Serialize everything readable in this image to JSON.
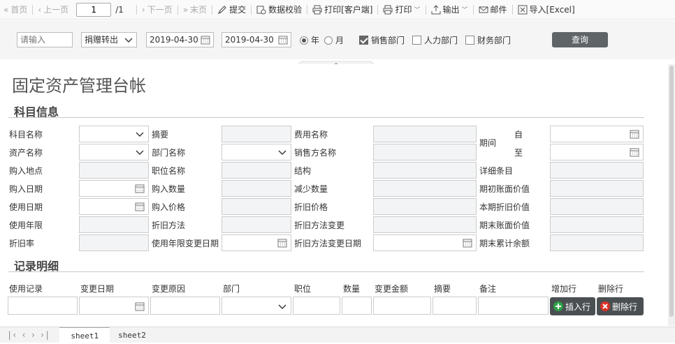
{
  "toolbar": {
    "first": "首页",
    "prev": "上一页",
    "page_value": "1",
    "page_total": "/1",
    "next": "下一页",
    "last": "末页",
    "submit": "提交",
    "validate": "数据校验",
    "print_client": "打印[客户端]",
    "print": "打印",
    "export": "输出",
    "mail": "邮件",
    "import_excel": "导入[Excel]"
  },
  "query": {
    "input_placeholder": "请输入",
    "select_value": "捐赠转出",
    "date_from": "2019-04-30",
    "date_to": "2019-04-30",
    "radio_year": "年",
    "radio_month": "月",
    "cb_sales": "销售部门",
    "cb_hr": "人力部门",
    "cb_finance": "财务部门",
    "search_button": "查询"
  },
  "title": "固定资产管理台帐",
  "section_subject": "科目信息",
  "section_records": "记录明细",
  "labels": {
    "subject_name": "科目名称",
    "summary": "摘要",
    "expense_name": "费用名称",
    "period": "期间",
    "from": "自",
    "to": "至",
    "asset_name": "资产名称",
    "dept_name": "部门名称",
    "seller_name": "销售方名称",
    "purchase_place": "购入地点",
    "position_name": "职位名称",
    "structure": "结构",
    "detail_items": "详细条目",
    "purchase_date": "购入日期",
    "purchase_qty": "购入数量",
    "decrease_qty": "减少数量",
    "opening_book_value": "期初账面价值",
    "use_date": "使用日期",
    "purchase_price": "购入价格",
    "depreciation_price": "折旧价格",
    "current_depreciation": "本期折旧价值",
    "useful_life": "使用年限",
    "depreciation_method": "折旧方法",
    "depreciation_method_change": "折旧方法变更",
    "closing_book_value": "期末账面价值",
    "depreciation_rate": "折旧率",
    "life_change_date": "使用年限变更日期",
    "method_change_date": "折旧方法变更日期",
    "closing_accum_balance": "期末累计余额"
  },
  "records": {
    "columns": [
      "使用记录",
      "变更日期",
      "变更原因",
      "部门",
      "职位",
      "数量",
      "变更金额",
      "摘要",
      "备注",
      "增加行",
      "删除行"
    ],
    "insert_button": "插入行",
    "delete_button": "删除行"
  },
  "sheets": [
    "sheet1",
    "sheet2"
  ],
  "colors": {
    "search_btn": "#5f6466",
    "insert_btn": "#4a4f52",
    "plus_green": "#2ea043",
    "delete_red": "#d93025"
  }
}
